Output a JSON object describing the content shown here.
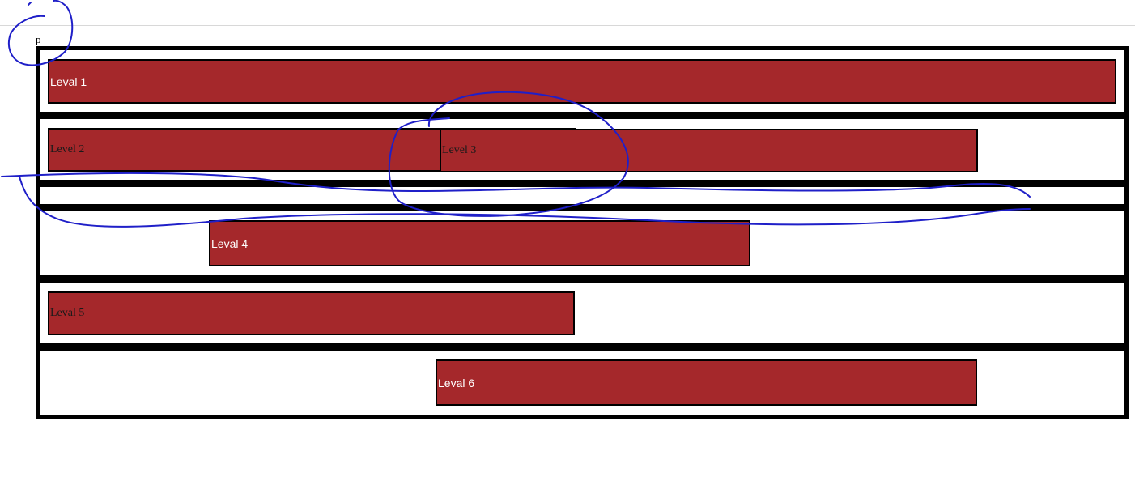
{
  "page": {
    "element_label": "p"
  },
  "rows": [
    {
      "label": "Leval 1",
      "font": "sans"
    },
    {
      "label": "Level 2",
      "font": "serif"
    },
    {
      "label": "Level 3",
      "font": "serif"
    },
    {
      "label": "Leval 4",
      "font": "sans"
    },
    {
      "label": "Leval 5",
      "font": "serif"
    },
    {
      "label": "Leval 6",
      "font": "sans"
    }
  ],
  "colors": {
    "bar_fill": "#a5282b",
    "border": "#000000",
    "annotation_ink": "#1f1fc8"
  }
}
